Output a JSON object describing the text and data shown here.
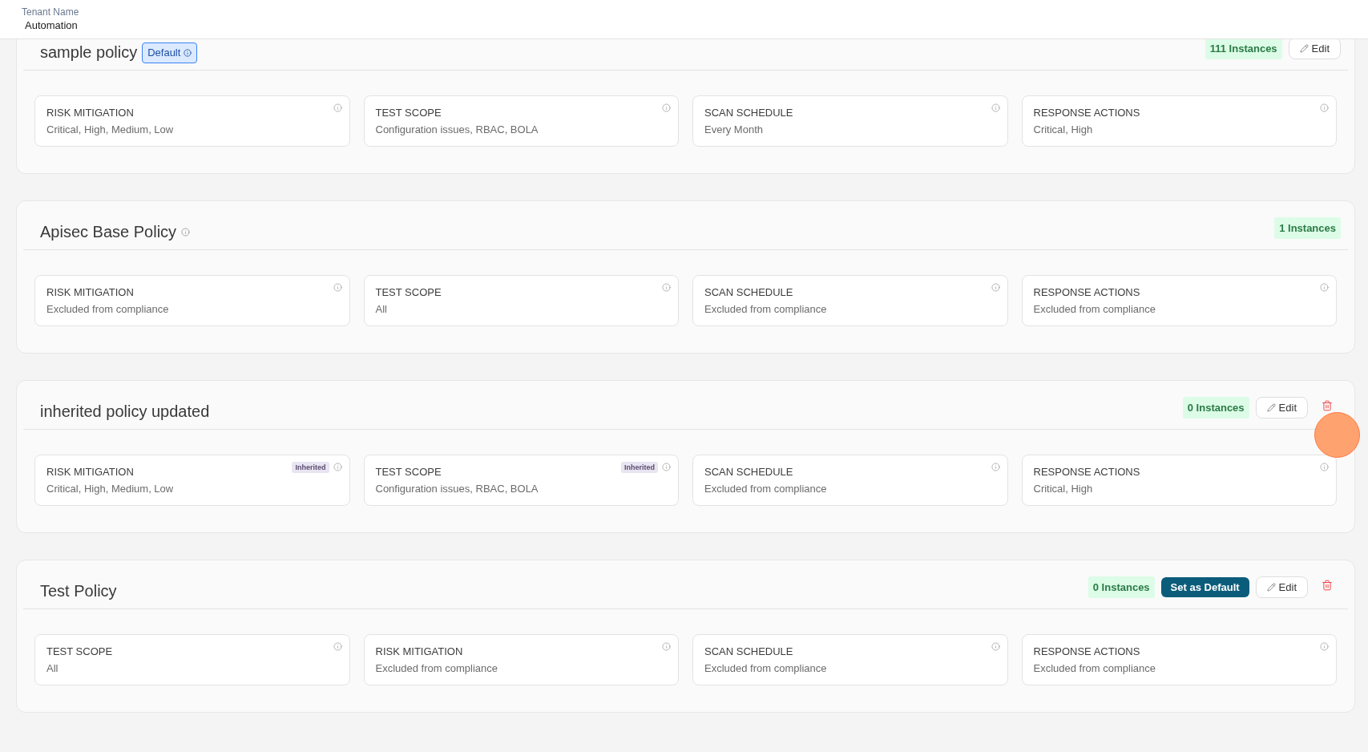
{
  "header": {
    "label": "Tenant Name",
    "value": "Automation"
  },
  "policies": [
    {
      "name": "sample policy",
      "badge": "Default",
      "name_info": false,
      "instances": "111 Instances",
      "actions": [
        {
          "kind": "edit",
          "label": "Edit"
        }
      ],
      "click_highlight": false,
      "sections": [
        {
          "title": "RISK MITIGATION",
          "value": "Critical, High, Medium, Low"
        },
        {
          "title": "TEST SCOPE",
          "value": "Configuration issues, RBAC, BOLA"
        },
        {
          "title": "SCAN SCHEDULE",
          "value": "Every Month"
        },
        {
          "title": "RESPONSE ACTIONS",
          "value": "Critical, High"
        }
      ]
    },
    {
      "name": "Apisec Base Policy",
      "name_info": true,
      "instances": "1 Instances",
      "click_highlight": false,
      "sections": [
        {
          "title": "RISK MITIGATION",
          "value": "Excluded from compliance"
        },
        {
          "title": "TEST SCOPE",
          "value": "All"
        },
        {
          "title": "SCAN SCHEDULE",
          "value": "Excluded from compliance"
        },
        {
          "title": "RESPONSE ACTIONS",
          "value": "Excluded from compliance"
        }
      ]
    },
    {
      "name": "inherited policy updated",
      "name_info": false,
      "instances": "0 Instances",
      "actions": [
        {
          "kind": "edit",
          "label": "Edit"
        },
        {
          "kind": "delete"
        }
      ],
      "click_highlight": true,
      "sections": [
        {
          "title": "RISK MITIGATION",
          "value": "Critical, High, Medium, Low",
          "badge": "Inherited"
        },
        {
          "title": "TEST SCOPE",
          "value": "Configuration issues, RBAC, BOLA",
          "badge": "Inherited"
        },
        {
          "title": "SCAN SCHEDULE",
          "value": "Excluded from compliance"
        },
        {
          "title": "RESPONSE ACTIONS",
          "value": "Critical, High"
        }
      ]
    },
    {
      "name": "Test Policy",
      "name_info": false,
      "instances": "0 Instances",
      "actions": [
        {
          "kind": "set_default",
          "label": "Set as Default"
        },
        {
          "kind": "edit",
          "label": "Edit"
        },
        {
          "kind": "delete"
        }
      ],
      "click_highlight": false,
      "sections": [
        {
          "title": "TEST SCOPE",
          "value": "All"
        },
        {
          "title": "RISK MITIGATION",
          "value": "Excluded from compliance"
        },
        {
          "title": "SCAN SCHEDULE",
          "value": "Excluded from compliance"
        },
        {
          "title": "RESPONSE ACTIONS",
          "value": "Excluded from compliance"
        }
      ]
    }
  ]
}
